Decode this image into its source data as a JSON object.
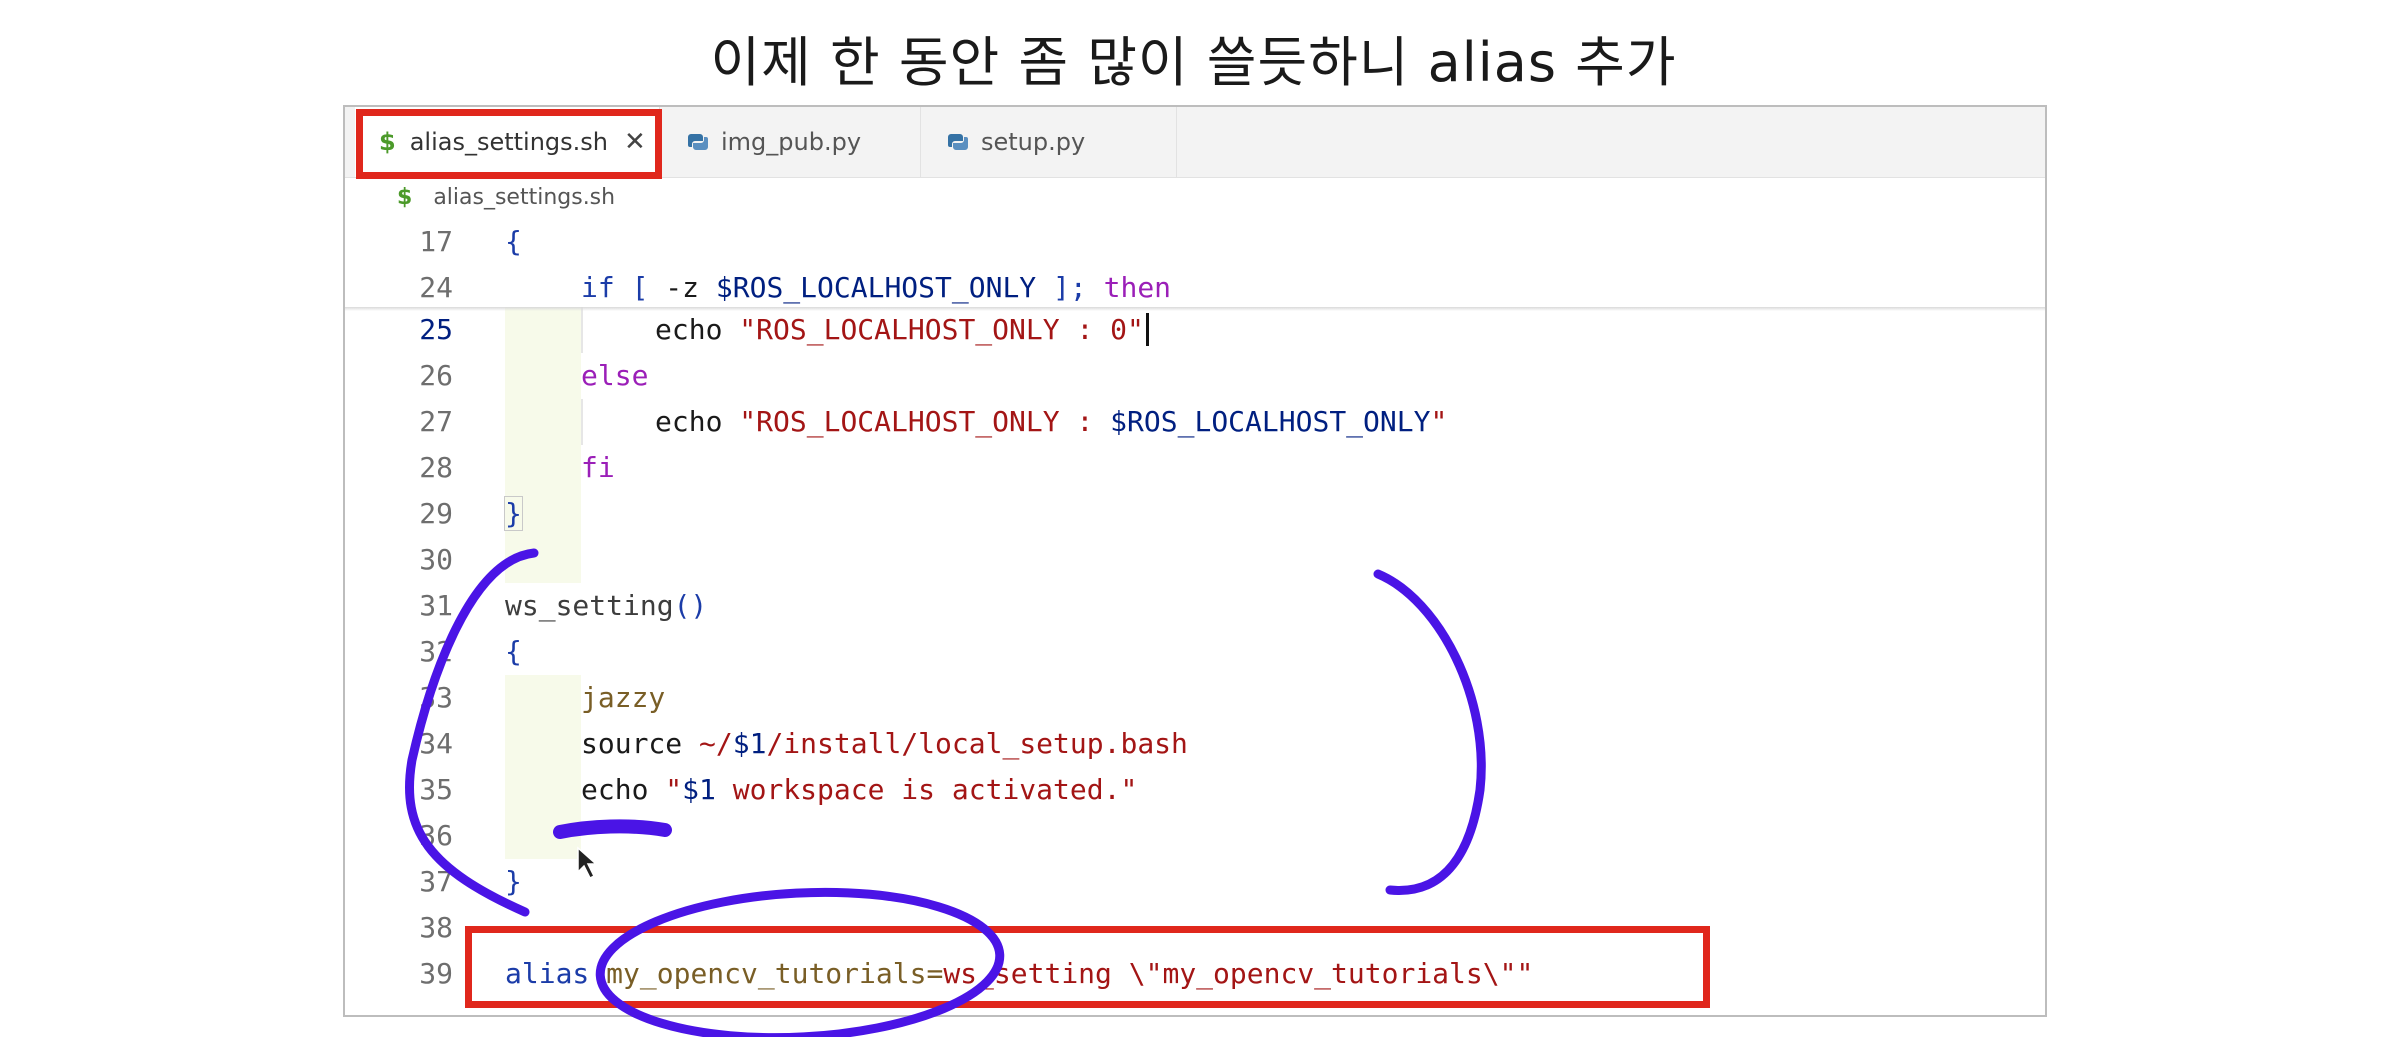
{
  "caption": "이제 한 동안 좀 많이 쓸듯하니 alias 추가",
  "tabs": [
    {
      "icon": "$",
      "label": "alias_settings.sh",
      "close": "✕",
      "active": true
    },
    {
      "label": "img_pub.py",
      "active": false
    },
    {
      "label": "setup.py",
      "active": false
    }
  ],
  "breadcrumb": {
    "icon": "$",
    "label": "alias_settings.sh"
  },
  "code_lines": [
    {
      "ln": "17",
      "text": "{"
    },
    {
      "ln": "24",
      "if": "if",
      "bracket_open": "[",
      "flag": "-z",
      "var": "$ROS_LOCALHOST_ONLY",
      "bracket_close": "];",
      "then": "then"
    },
    {
      "ln": "25",
      "cmd": "echo",
      "str": "\"ROS_LOCALHOST_ONLY : 0\""
    },
    {
      "ln": "26",
      "text": "else"
    },
    {
      "ln": "27",
      "cmd": "echo",
      "str_a": "\"ROS_LOCALHOST_ONLY : ",
      "var": "$ROS_LOCALHOST_ONLY",
      "str_b": "\""
    },
    {
      "ln": "28",
      "text": "fi"
    },
    {
      "ln": "29",
      "text": "}"
    },
    {
      "ln": "30",
      "text": ""
    },
    {
      "ln": "31",
      "fn": "ws_setting",
      "parens": "()"
    },
    {
      "ln": "32",
      "text": "{"
    },
    {
      "ln": "33",
      "text": "jazzy"
    },
    {
      "ln": "34",
      "cmd": "source",
      "path_a": "~/",
      "var": "$1",
      "path_b": "/install/local_setup.bash"
    },
    {
      "ln": "35",
      "cmd": "echo",
      "str_a": "\"",
      "var": "$1",
      "str_b": " workspace is activated.\""
    },
    {
      "ln": "36",
      "text": ""
    },
    {
      "ln": "37",
      "text": "}"
    },
    {
      "ln": "38",
      "text": ""
    },
    {
      "ln": "39",
      "alias": "alias",
      "name": "my_opencv_tutorials=",
      "value": "ws_setting \\\"my_opencv_tutorials\\\"\""
    }
  ],
  "colors": {
    "annotation_box": "#e0271c",
    "pen_stroke": "#4a14e6",
    "keyword": "#1b3ca8",
    "string": "#a31515"
  }
}
